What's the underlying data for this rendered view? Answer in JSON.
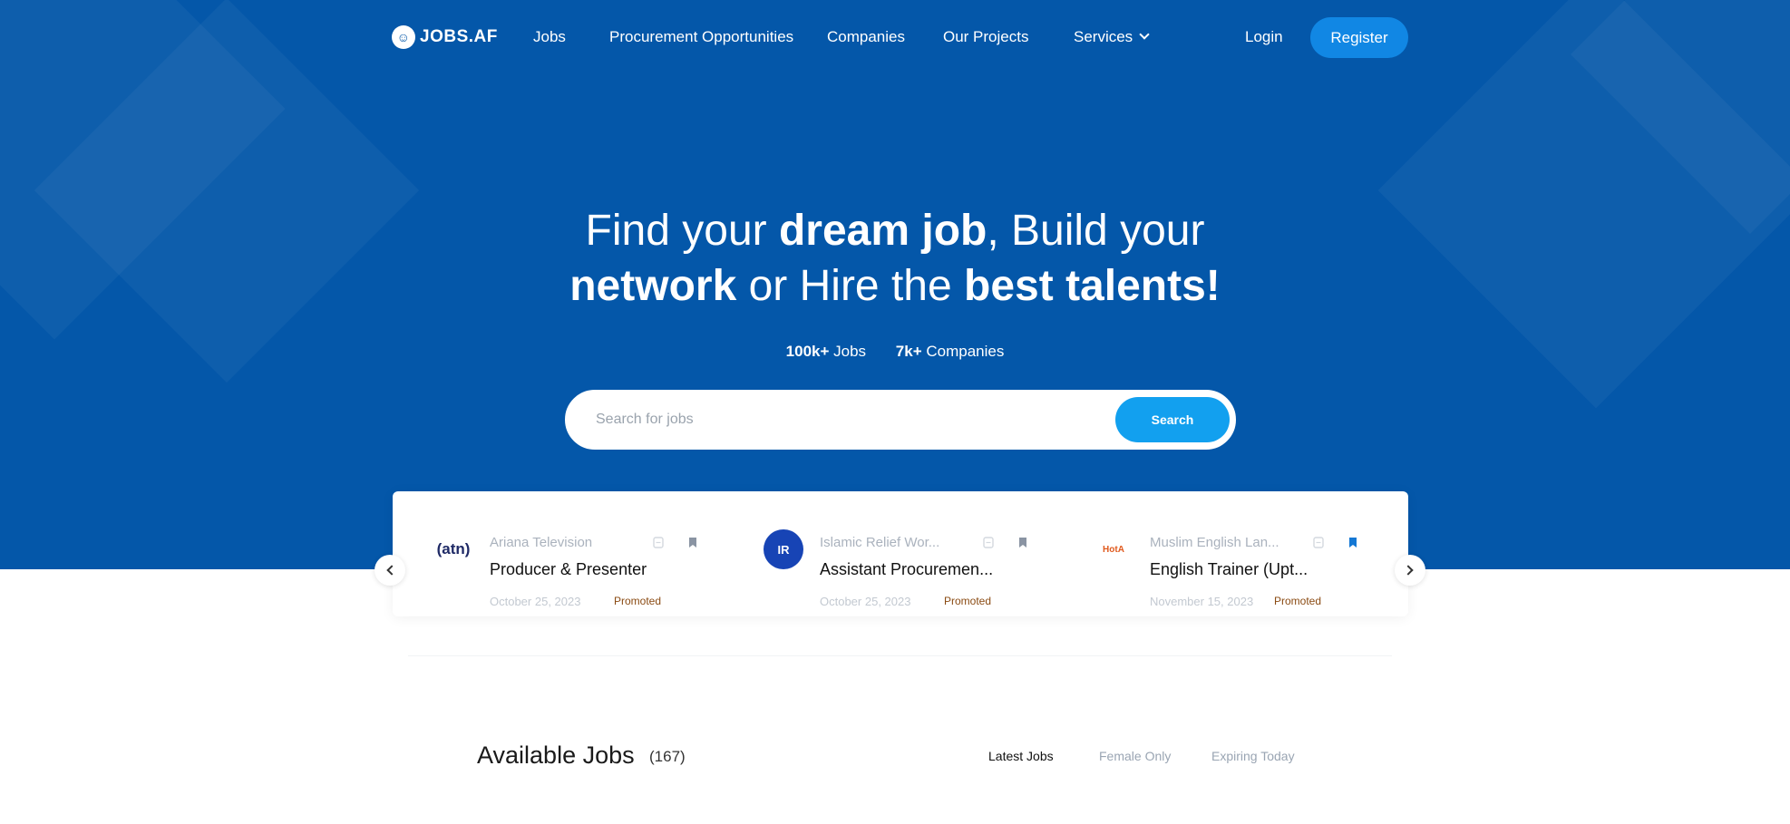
{
  "brand": {
    "name": "JOBS.AF",
    "accent": "#0457a9",
    "button_blue": "#12a0ef"
  },
  "nav": {
    "items": [
      {
        "label": "Jobs"
      },
      {
        "label": "Procurement Opportunities"
      },
      {
        "label": "Companies"
      },
      {
        "label": "Our Projects"
      },
      {
        "label": "Services"
      }
    ],
    "login": "Login",
    "register": "Register"
  },
  "hero": {
    "line1_a": "Find your ",
    "line1_b": "dream job",
    "line1_c": ", Build your",
    "line2_a": "network",
    "line2_b": " or Hire the ",
    "line2_c": "best talents!",
    "stat_jobs_num": "100k+",
    "stat_jobs_label": " Jobs",
    "stat_companies_num": "7k+",
    "stat_companies_label": " Companies"
  },
  "search": {
    "placeholder": "Search for jobs",
    "button": "Search"
  },
  "featured_jobs": [
    {
      "company": "Ariana Television",
      "logo_text": "(atn)",
      "title": "Producer & Presenter",
      "date": "October 25, 2023",
      "badge": "Promoted",
      "bookmarked": false
    },
    {
      "company": "Islamic Relief Wor...",
      "logo_text": "IR",
      "title": "Assistant Procuremen...",
      "date": "October 25, 2023",
      "badge": "Promoted",
      "bookmarked": false
    },
    {
      "company": "Muslim English Lan...",
      "logo_text": "HotA",
      "title": "English Trainer (Upt...",
      "date": "November 15, 2023",
      "badge": "Promoted",
      "bookmarked": true
    }
  ],
  "available": {
    "title": "Available Jobs",
    "count": "(167)",
    "tabs": [
      {
        "label": "Latest Jobs",
        "active": true
      },
      {
        "label": "Female Only",
        "active": false
      },
      {
        "label": "Expiring Today",
        "active": false
      }
    ]
  }
}
